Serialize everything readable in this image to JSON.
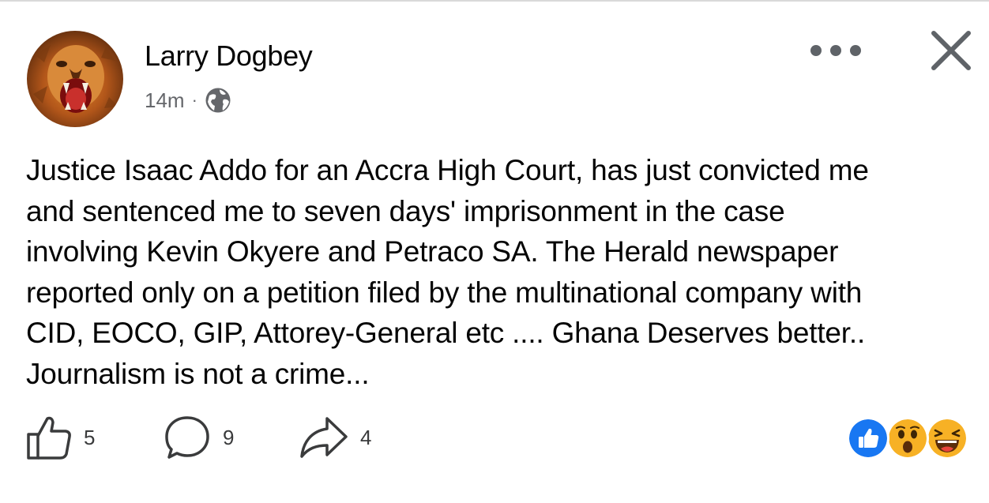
{
  "post": {
    "author": "Larry Dogbey",
    "timestamp": "14m",
    "separator": "·",
    "audience_icon": "globe-icon",
    "text_lines": [
      "Justice Isaac Addo for an Accra High Court, has just convicted me",
      "and sentenced me to seven days' imprisonment in the case",
      "involving Kevin Okyere and Petraco SA. The Herald newspaper",
      "reported only on a petition filed by the multinational company with",
      "CID, EOCO, GIP, Attorey-General etc .... Ghana Deserves better..",
      "Journalism is not a crime..."
    ]
  },
  "header_actions": {
    "more_icon": "more-horizontal-icon",
    "close_icon": "close-icon"
  },
  "stats": {
    "likes": "5",
    "comments": "9",
    "shares": "4"
  },
  "reactions": [
    "like",
    "wow",
    "haha"
  ],
  "colors": {
    "text": "#050505",
    "secondary_text": "#65676b",
    "like_blue": "#1877f2",
    "emoji_yellow": "#f7b125"
  }
}
